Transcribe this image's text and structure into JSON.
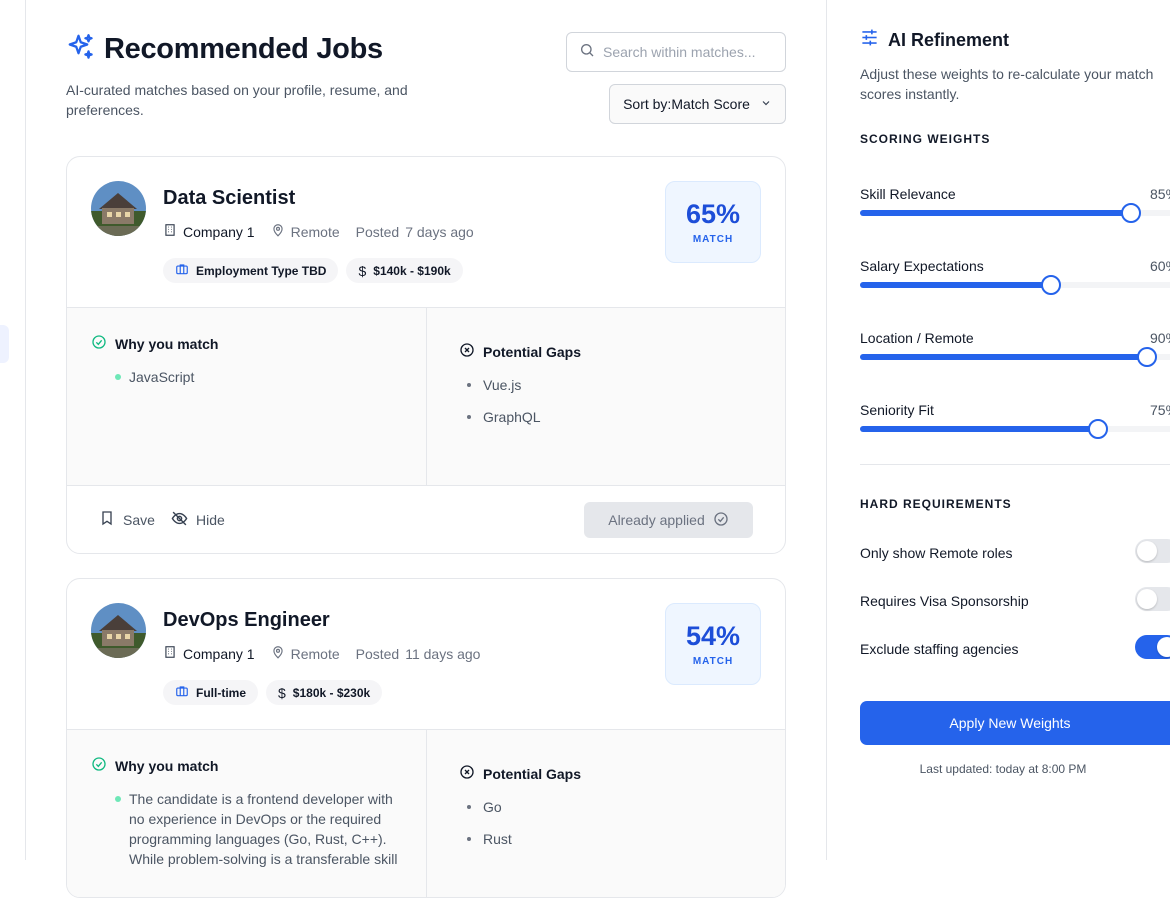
{
  "header": {
    "title": "Recommended Jobs",
    "subtitle": "AI-curated matches based on your profile, resume, and preferences.",
    "search_placeholder": "Search within matches...",
    "sort_prefix": "Sort by:",
    "sort_value": "Match Score"
  },
  "jobs": [
    {
      "title": "Data Scientist",
      "company": "Company 1",
      "location": "Remote",
      "posted_prefix": "Posted",
      "posted": "7 days ago",
      "employment": "Employment Type TBD",
      "salary": "$140k - $190k",
      "match": "65%",
      "match_label": "MATCH",
      "why_heading": "Why you match",
      "why": [
        "JavaScript"
      ],
      "gaps_heading": "Potential Gaps",
      "gaps": [
        "Vue.js",
        "GraphQL"
      ],
      "save_label": "Save",
      "hide_label": "Hide",
      "applied_label": "Already applied"
    },
    {
      "title": "DevOps Engineer",
      "company": "Company 1",
      "location": "Remote",
      "posted_prefix": "Posted",
      "posted": "11 days ago",
      "employment": "Full-time",
      "salary": "$180k - $230k",
      "match": "54%",
      "match_label": "MATCH",
      "why_heading": "Why you match",
      "why": [
        "The candidate is a frontend developer with no experience in DevOps or the required programming languages (Go, Rust, C++). While problem-solving is a transferable skill"
      ],
      "gaps_heading": "Potential Gaps",
      "gaps": [
        "Go",
        "Rust"
      ]
    }
  ],
  "panel": {
    "title": "AI Refinement",
    "description": "Adjust these weights to re-calculate your match scores instantly.",
    "weights_heading": "SCORING WEIGHTS",
    "weights": [
      {
        "label": "Skill Relevance",
        "value": "85%",
        "level": 0.82
      },
      {
        "label": "Salary Expectations",
        "value": "60%",
        "level": 0.58
      },
      {
        "label": "Location / Remote",
        "value": "90%",
        "level": 0.87
      },
      {
        "label": "Seniority Fit",
        "value": "75%",
        "level": 0.72
      }
    ],
    "requirements_heading": "HARD REQUIREMENTS",
    "requirements": [
      {
        "label": "Only show Remote roles",
        "on": false
      },
      {
        "label": "Requires Visa Sponsorship",
        "on": false
      },
      {
        "label": "Exclude staffing agencies",
        "on": true
      }
    ],
    "apply_label": "Apply New Weights",
    "last_updated": "Last updated: today at 8:00 PM"
  },
  "colors": {
    "accent": "#2563eb",
    "match_text": "#1d4ed8",
    "success": "#10b981"
  }
}
